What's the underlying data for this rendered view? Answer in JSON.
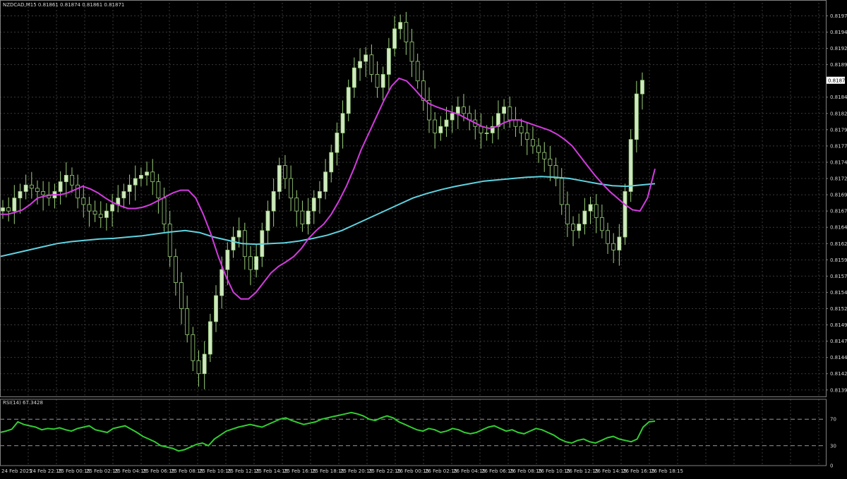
{
  "main_header": "NZDCAD,M15  0.81861 0.81874 0.81861 0.81871",
  "rsi_header": "RSI(14) 67.3428",
  "colors": {
    "background": "#000000",
    "grid": "#3a3a3a",
    "bull_body": "#cfe8c0",
    "bear_body": "#000000",
    "candle_outline": "#9ad07a",
    "ma_fast": "#d43be0",
    "ma_slow": "#5fd3e0",
    "rsi_line": "#32cd32",
    "current_price_box": "#ffffff"
  },
  "current_price_label": "0.81871",
  "price_axis_labels": [
    "0.81970",
    "0.81945",
    "0.81920",
    "0.81895",
    "0.81845",
    "0.81820",
    "0.81795",
    "0.81770",
    "0.81745",
    "0.81720",
    "0.81695",
    "0.81670",
    "0.81645",
    "0.81620",
    "0.81595",
    "0.81570",
    "0.81545",
    "0.81520",
    "0.81495",
    "0.81470",
    "0.81445",
    "0.81420",
    "0.81395"
  ],
  "rsi_axis_labels": [
    "70",
    "30",
    "0"
  ],
  "time_axis_labels": [
    "24 Feb 2025",
    "24 Feb 22:15",
    "25 Feb 00:15",
    "25 Feb 02:15",
    "25 Feb 04:15",
    "25 Feb 06:15",
    "25 Feb 08:15",
    "25 Feb 10:15",
    "25 Feb 12:15",
    "25 Feb 14:15",
    "25 Feb 16:15",
    "25 Feb 18:15",
    "25 Feb 20:15",
    "25 Feb 22:15",
    "26 Feb 00:15",
    "26 Feb 02:15",
    "26 Feb 04:15",
    "26 Feb 06:15",
    "26 Feb 08:15",
    "26 Feb 10:15",
    "26 Feb 12:15",
    "26 Feb 14:15",
    "26 Feb 16:15",
    "26 Feb 18:15"
  ],
  "chart_data": [
    {
      "type": "candlestick",
      "title": "NZDCAD,M15",
      "ylim": [
        0.81385,
        0.8199
      ],
      "close_series_approx": [
        0.81675,
        0.8167,
        0.8169,
        0.817,
        0.8171,
        0.81705,
        0.817,
        0.81695,
        0.8169,
        0.817,
        0.81715,
        0.81725,
        0.8171,
        0.8169,
        0.8168,
        0.8167,
        0.81665,
        0.8166,
        0.8167,
        0.8168,
        0.8169,
        0.817,
        0.8171,
        0.8172,
        0.81725,
        0.8173,
        0.81715,
        0.8169,
        0.8165,
        0.816,
        0.8156,
        0.8152,
        0.8148,
        0.8144,
        0.8142,
        0.8145,
        0.815,
        0.8154,
        0.8158,
        0.8161,
        0.8163,
        0.8164,
        0.816,
        0.8158,
        0.816,
        0.8164,
        0.8167,
        0.817,
        0.8174,
        0.8172,
        0.8169,
        0.8167,
        0.8165,
        0.8167,
        0.8169,
        0.817,
        0.8173,
        0.8176,
        0.8179,
        0.8182,
        0.8186,
        0.8189,
        0.819,
        0.8191,
        0.8188,
        0.8186,
        0.8188,
        0.8192,
        0.8195,
        0.8196,
        0.8193,
        0.819,
        0.8187,
        0.8184,
        0.8181,
        0.8179,
        0.818,
        0.8181,
        0.8182,
        0.8183,
        0.8182,
        0.8181,
        0.818,
        0.8179,
        0.8179,
        0.818,
        0.8182,
        0.8183,
        0.8181,
        0.818,
        0.8179,
        0.8178,
        0.8177,
        0.8176,
        0.8175,
        0.8174,
        0.8172,
        0.8168,
        0.8165,
        0.8164,
        0.8165,
        0.8167,
        0.8168,
        0.8166,
        0.8164,
        0.8162,
        0.8161,
        0.8163,
        0.817,
        0.8178,
        0.8185,
        0.81871
      ],
      "ma_fast_approx": [
        0.81665,
        0.81665,
        0.81668,
        0.81672,
        0.8168,
        0.8169,
        0.81693,
        0.81695,
        0.81695,
        0.81698,
        0.81703,
        0.81708,
        0.81704,
        0.81698,
        0.8169,
        0.81683,
        0.81678,
        0.81674,
        0.81674,
        0.81676,
        0.8168,
        0.81686,
        0.81692,
        0.81698,
        0.81702,
        0.81702,
        0.8169,
        0.81665,
        0.81635,
        0.816,
        0.8157,
        0.81545,
        0.81535,
        0.81535,
        0.81545,
        0.8156,
        0.81575,
        0.81585,
        0.81592,
        0.816,
        0.81612,
        0.81628,
        0.8164,
        0.8165,
        0.81665,
        0.81685,
        0.81708,
        0.81735,
        0.81765,
        0.8179,
        0.81815,
        0.8184,
        0.81862,
        0.81874,
        0.8187,
        0.81858,
        0.81845,
        0.81835,
        0.8183,
        0.81826,
        0.81822,
        0.81818,
        0.81812,
        0.81806,
        0.818,
        0.81797,
        0.818,
        0.81806,
        0.8181,
        0.8181,
        0.81806,
        0.81802,
        0.81798,
        0.81794,
        0.81788,
        0.8178,
        0.8177,
        0.81755,
        0.8174,
        0.81725,
        0.81712,
        0.817,
        0.8169,
        0.8168,
        0.81672,
        0.8167,
        0.8169,
        0.81735
      ],
      "ma_slow_approx": [
        0.816,
        0.81605,
        0.8161,
        0.81615,
        0.8162,
        0.81623,
        0.81625,
        0.81627,
        0.81628,
        0.8163,
        0.81632,
        0.81635,
        0.81638,
        0.8164,
        0.81637,
        0.8163,
        0.81625,
        0.8162,
        0.81619,
        0.8162,
        0.81621,
        0.81624,
        0.81628,
        0.81633,
        0.8164,
        0.8165,
        0.8166,
        0.8167,
        0.8168,
        0.8169,
        0.81697,
        0.81703,
        0.81708,
        0.81712,
        0.81716,
        0.81718,
        0.8172,
        0.81722,
        0.81723,
        0.81722,
        0.8172,
        0.81716,
        0.81712,
        0.81709,
        0.81708,
        0.8171,
        0.81712
      ]
    },
    {
      "type": "line",
      "title": "RSI(14) 67.3428",
      "ylim": [
        0,
        100
      ],
      "levels": [
        70,
        30
      ],
      "values_approx": [
        50,
        52,
        55,
        66,
        62,
        60,
        58,
        54,
        56,
        55,
        57,
        54,
        52,
        56,
        58,
        60,
        54,
        52,
        50,
        56,
        58,
        60,
        55,
        50,
        44,
        40,
        36,
        30,
        28,
        26,
        22,
        24,
        28,
        32,
        34,
        30,
        40,
        46,
        52,
        55,
        58,
        60,
        62,
        60,
        58,
        62,
        66,
        70,
        72,
        68,
        65,
        62,
        64,
        66,
        70,
        72,
        74,
        76,
        78,
        80,
        78,
        75,
        70,
        68,
        72,
        75,
        72,
        66,
        62,
        58,
        54,
        52,
        56,
        54,
        50,
        52,
        56,
        54,
        50,
        48,
        50,
        54,
        58,
        60,
        56,
        52,
        54,
        50,
        48,
        52,
        56,
        54,
        50,
        46,
        40,
        36,
        34,
        38,
        40,
        36,
        34,
        38,
        42,
        44,
        40,
        38,
        36,
        40,
        58,
        66,
        67
      ]
    }
  ]
}
